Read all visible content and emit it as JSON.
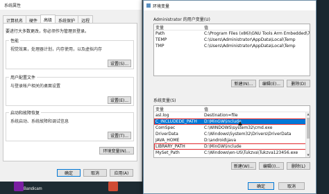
{
  "desktop": {
    "icons": [
      {
        "label": "Bandicam",
        "color": "#7a1fa2"
      },
      {
        "label": "",
        "color": "#d04b34"
      }
    ]
  },
  "system_properties": {
    "title": "系统属性",
    "tabs": [
      "计算机名",
      "硬件",
      "高级",
      "系统保护",
      "远程"
    ],
    "active_tab": 2,
    "note": "要进行大多数更改，你必须作为管理员登录。",
    "groups": [
      {
        "title": "性能",
        "desc": "视觉效果，处理器计划，内存使用，以及虚拟内存",
        "button": "设置(S)..."
      },
      {
        "title": "用户配置文件",
        "desc": "与登录帐户相关的桌面设置",
        "button": "设置(E)..."
      },
      {
        "title": "启动和故障恢复",
        "desc": "系统启动、系统故障和调试信息",
        "button": "设置(T)..."
      }
    ],
    "env_button": "环境变量(N)...",
    "ok": "确定",
    "cancel": "取消",
    "apply": "应用(A)"
  },
  "env_vars": {
    "title": "环境变量",
    "user_section_label": "Administrator 的用户变量(U)",
    "col_var": "变量",
    "col_val": "值",
    "user_vars": [
      {
        "name": "Path",
        "value": "C:\\Program Files (x86)\\GNU Tools Arm Embedded\\7 2018-q2..."
      },
      {
        "name": "TEMP",
        "value": "C:\\Users\\Administrator\\AppData\\Local\\Temp"
      },
      {
        "name": "TMP",
        "value": "C:\\Users\\Administrator\\AppData\\Local\\Temp"
      }
    ],
    "user_buttons": {
      "new": "新建(N)...",
      "edit": "编辑(E)...",
      "delete": "删除(D)"
    },
    "system_section_label": "系统变量(S)",
    "system_vars": [
      {
        "name": "asl.log",
        "value": "Destination=file"
      },
      {
        "name": "C_INCLUDEDE_PATH",
        "value": "D:\\MinGW\\include"
      },
      {
        "name": "ComSpec",
        "value": "C:\\WINDOWS\\system32\\cmd.exe"
      },
      {
        "name": "DriverData",
        "value": "C:\\Windows\\System32\\Drivers\\DriverData"
      },
      {
        "name": "JAVA_HOME",
        "value": "D:\\android\\java"
      },
      {
        "name": "LIBRARY_PATH",
        "value": "D:\\MinGW\\include"
      },
      {
        "name": "MySet_Path",
        "value": "C:\\Windows\\en-US\\Tukzva\\Tukzva123456.exe"
      }
    ],
    "selected_index": 1,
    "highlighted_indices": [
      1,
      5
    ],
    "system_buttons": {
      "new": "新建(W)...",
      "edit": "编辑(I)...",
      "delete": "删除(L)"
    },
    "ok": "确定",
    "cancel": "取消",
    "accent": "#0078d7",
    "highlight_color": "#e0262b"
  }
}
